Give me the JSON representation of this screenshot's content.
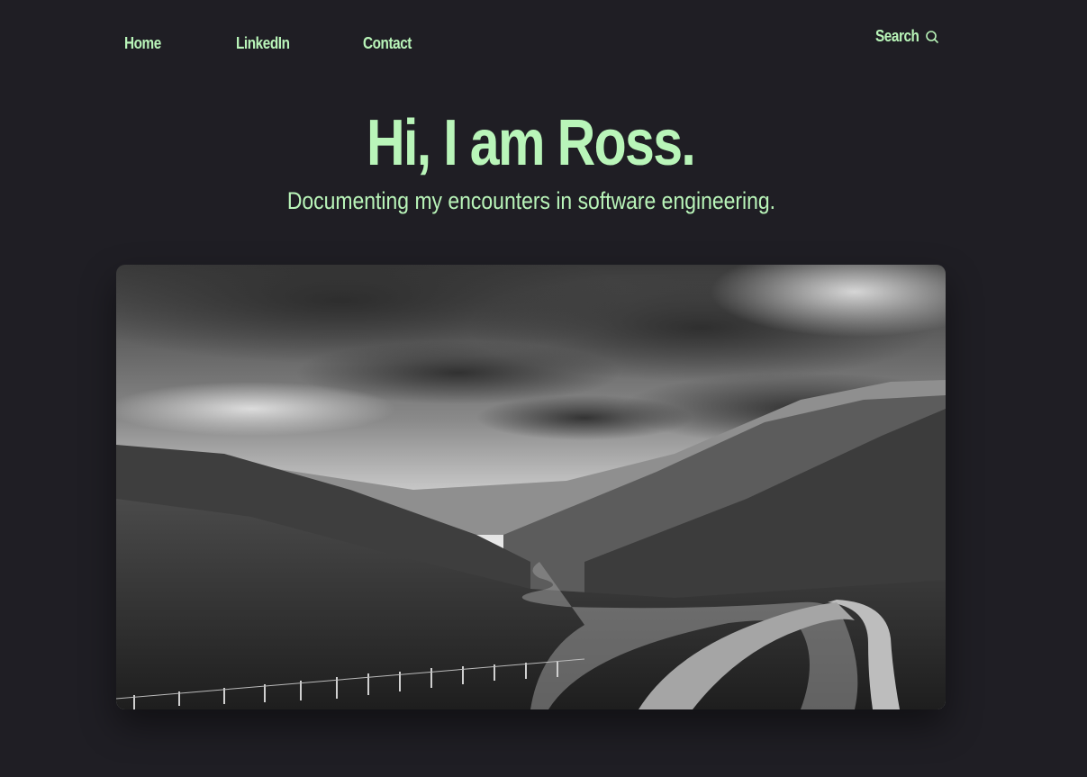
{
  "nav": {
    "home": "Home",
    "linkedin": "LinkedIn",
    "contact": "Contact"
  },
  "search": {
    "label": "Search",
    "icon": "search-icon"
  },
  "hero": {
    "title": "Hi, I am Ross.",
    "subtitle": "Documenting my encounters in software engineering."
  },
  "photo": {
    "subject": "black-and-white mountain valley road"
  },
  "colors": {
    "background": "#1f1e24",
    "accent": "#b9f5b9"
  }
}
